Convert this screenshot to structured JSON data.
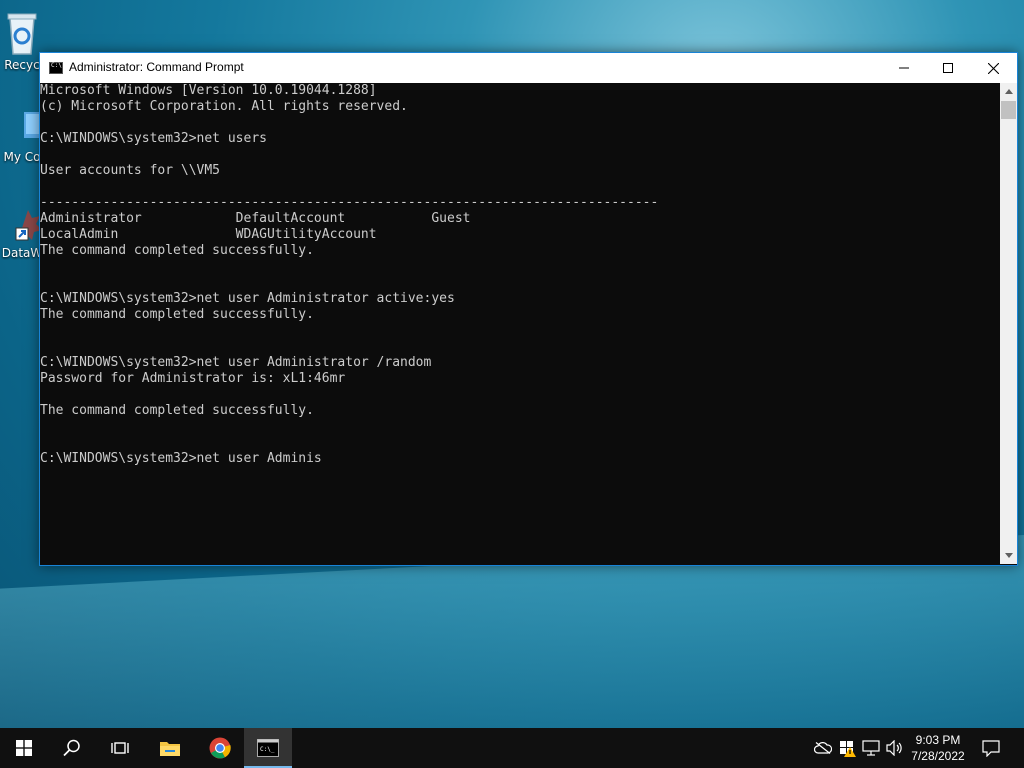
{
  "desktop": {
    "icons": [
      {
        "label": "Recyc",
        "name": "recycle-bin"
      },
      {
        "label": "My Co",
        "name": "my-computer"
      },
      {
        "label": "DataW",
        "name": "dataw-shortcut"
      }
    ]
  },
  "window": {
    "title": "Administrator: Command Prompt",
    "lines": [
      "Microsoft Windows [Version 10.0.19044.1288]",
      "(c) Microsoft Corporation. All rights reserved.",
      "",
      "C:\\WINDOWS\\system32>net users",
      "",
      "User accounts for \\\\VM5",
      "",
      "-------------------------------------------------------------------------------",
      "Administrator            DefaultAccount           Guest",
      "LocalAdmin               WDAGUtilityAccount",
      "The command completed successfully.",
      "",
      "",
      "C:\\WINDOWS\\system32>net user Administrator active:yes",
      "The command completed successfully.",
      "",
      "",
      "C:\\WINDOWS\\system32>net user Administrator /random",
      "Password for Administrator is: xL1:46mr",
      "",
      "The command completed successfully.",
      "",
      "",
      "C:\\WINDOWS\\system32>net user Adminis"
    ]
  },
  "taskbar": {
    "apps": [
      {
        "name": "start-button"
      },
      {
        "name": "search-button"
      },
      {
        "name": "task-view-button"
      },
      {
        "name": "file-explorer-button"
      },
      {
        "name": "chrome-button"
      },
      {
        "name": "cmd-button",
        "active": true
      }
    ],
    "clock": {
      "time": "9:03 PM",
      "date": "7/28/2022"
    }
  },
  "colors": {
    "console_bg": "#0c0c0c",
    "console_text": "#cccccc",
    "taskbar_bg": "#101010",
    "accent": "#76b9ed"
  }
}
